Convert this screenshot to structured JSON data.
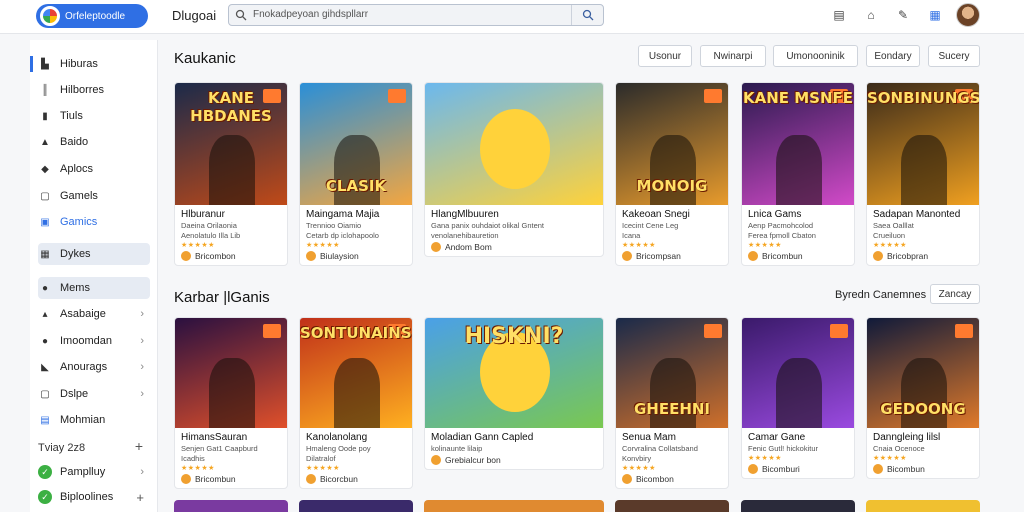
{
  "header": {
    "logo_text": "Orfeleptoodle",
    "app_name": "Dlugoai",
    "search_placeholder": "Fnokadpeyoan gihdspllarr"
  },
  "sidebar": {
    "items": [
      {
        "label": "Hiburas",
        "icon": "home-icon"
      },
      {
        "label": "Hilborres",
        "icon": "bars-icon"
      },
      {
        "label": "Tiuls",
        "icon": "bookmark-icon"
      },
      {
        "label": "Baido",
        "icon": "user-icon"
      },
      {
        "label": "Aplocs",
        "icon": "apps-icon"
      },
      {
        "label": "Gamels",
        "icon": "square-icon"
      },
      {
        "label": "Gamics",
        "icon": "gamepad-icon"
      },
      {
        "label": "Dykes",
        "icon": "grid-icon"
      },
      {
        "label": "Mems",
        "icon": "circle-icon"
      },
      {
        "label": "Asabaige",
        "icon": "person-icon"
      },
      {
        "label": "Imoomdan",
        "icon": "circle-icon"
      },
      {
        "label": "Anourags",
        "icon": "chat-icon"
      },
      {
        "label": "Dslpe",
        "icon": "square-icon"
      },
      {
        "label": "Mohmian",
        "icon": "film-icon"
      }
    ],
    "section_label": "Tviay 2z8",
    "sub_items": [
      {
        "label": "Pamplluy"
      },
      {
        "label": "Biploolines"
      }
    ]
  },
  "section1": {
    "title": "Kaukanic",
    "chips": [
      "Usonur",
      "Nwinarpi",
      "Umonooninik",
      "Eondary",
      "Sucery"
    ]
  },
  "section2": {
    "title": "Karbar |lGanis",
    "sort_label": "Byredn Canemnes",
    "sort_value": "Zancay"
  },
  "cards_row1": [
    {
      "title": "Hlburanur",
      "desc1": "Daeina Orilaonia",
      "desc2": "Aenolatulo Illa Lib",
      "foot": "Bricombon",
      "overlay": "KANE HBDANES",
      "colors": [
        "#1b2a4a",
        "#c04a18"
      ]
    },
    {
      "title": "Maingama Majia",
      "desc1": "Trennioo Oiamio",
      "desc2": "Cetarb dp iclohapoolo",
      "foot": "Biulaysion",
      "overlay": "CLASIK",
      "colors": [
        "#2a8fd8",
        "#f3a640"
      ]
    },
    {
      "title": "HlangMlbuuren",
      "desc1": "Gana panix ouhdaiot olikal Gntent",
      "desc2": "venolanehibauretion",
      "foot": "Andom Bom",
      "overlay": "",
      "colors": [
        "#6bb8ee",
        "#ffd23a"
      ]
    },
    {
      "title": "Kakeoan Snegi",
      "desc1": "Icecint Cene Leg",
      "desc2": "Icana",
      "foot": "Bricompsan",
      "overlay": "MONOIG",
      "colors": [
        "#2b2b2b",
        "#e89b2c"
      ]
    },
    {
      "title": "Lnica Gams",
      "desc1": "Aenp Pacmohcolod",
      "desc2": "Ferea fpmoll Cbaton",
      "foot": "Bricombun",
      "overlay": "KANE MSNFE",
      "colors": [
        "#2a1a4e",
        "#d14ac8"
      ]
    },
    {
      "title": "Sadapan Manonted",
      "desc1": "Saea Oalllat",
      "desc2": "Crueiluon",
      "foot": "Bricobpran",
      "overlay": "SONBINUNGS!",
      "colors": [
        "#3a2a1a",
        "#f0a020"
      ]
    }
  ],
  "cards_row2": [
    {
      "title": "HimansSauran",
      "desc1": "Senjen Gat1 Caapburd",
      "desc2": "Icadhis",
      "foot": "Bricombun",
      "overlay": "",
      "colors": [
        "#2a1040",
        "#e0502a"
      ]
    },
    {
      "title": "Kanolanolang",
      "desc1": "Hmaleng Oode poy",
      "desc2": "Dilatralof",
      "foot": "Bicorcbun",
      "overlay": "SONTUNAINS!",
      "colors": [
        "#c0301a",
        "#ffb020"
      ]
    },
    {
      "title": "Moladian Gann Capled",
      "desc1": "kolinaunte lilaip",
      "desc2": "",
      "foot": "Grebialcur bon",
      "overlay": "HISKNI?",
      "colors": [
        "#4aa0e8",
        "#7ac850"
      ]
    },
    {
      "title": "Senua Mam",
      "desc1": "Corvralina Collatsband",
      "desc2": "Konvbiry",
      "foot": "Bicombon",
      "overlay": "GHEEHNI",
      "colors": [
        "#1a2a4a",
        "#d0702a"
      ]
    },
    {
      "title": "Camar Gane",
      "desc1": "Fenic Gutl! hickokitur",
      "desc2": "",
      "foot": "Bicomburi",
      "overlay": "",
      "colors": [
        "#3a1a6a",
        "#9a4ae0"
      ]
    },
    {
      "title": "Danngleing lilsl",
      "desc1": "Cnaia Ocenoce",
      "desc2": "",
      "foot": "Bicombun",
      "overlay": "GEDOONG",
      "colors": [
        "#101a3a",
        "#e07a2a"
      ]
    }
  ]
}
